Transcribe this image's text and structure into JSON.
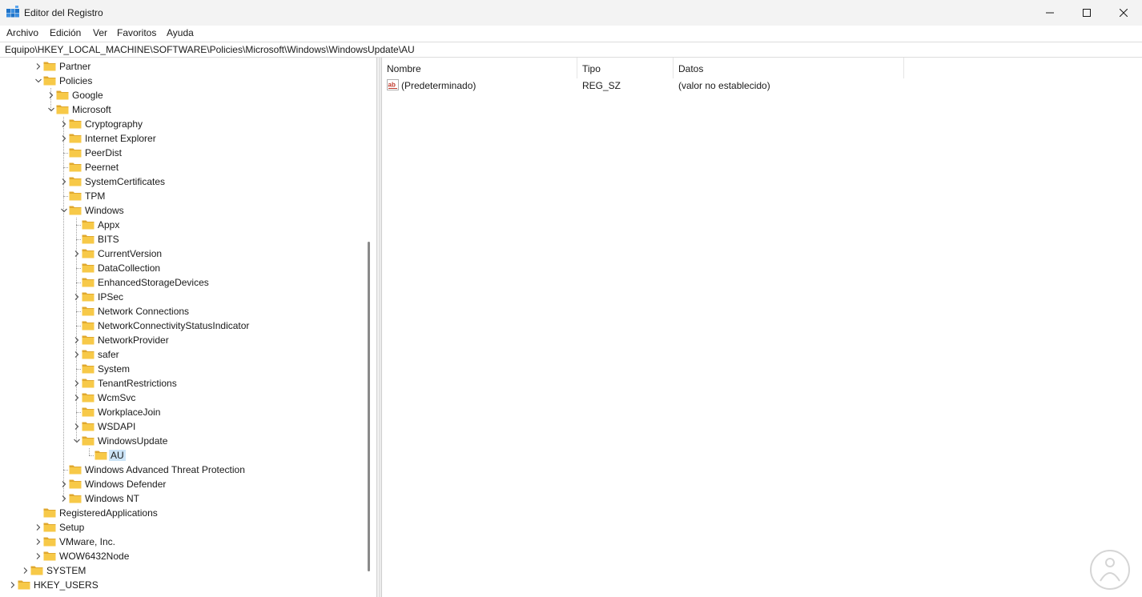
{
  "window": {
    "title": "Editor del Registro",
    "icon": "registry-editor-icon",
    "controls": [
      "minimize-icon",
      "maximize-icon",
      "close-icon"
    ]
  },
  "menu": {
    "items": [
      "Archivo",
      "Edición",
      "Ver",
      "Favoritos",
      "Ayuda"
    ]
  },
  "address": {
    "path": "Equipo\\HKEY_LOCAL_MACHINE\\SOFTWARE\\Policies\\Microsoft\\Windows\\WindowsUpdate\\AU"
  },
  "tree": {
    "items": [
      {
        "label": "Partner",
        "level": 3,
        "expander": "collapsed"
      },
      {
        "label": "Policies",
        "level": 3,
        "expander": "expanded"
      },
      {
        "label": "Google",
        "level": 4,
        "expander": "collapsed"
      },
      {
        "label": "Microsoft",
        "level": 4,
        "expander": "expanded"
      },
      {
        "label": "Cryptography",
        "level": 5,
        "expander": "collapsed"
      },
      {
        "label": "Internet Explorer",
        "level": 5,
        "expander": "collapsed"
      },
      {
        "label": "PeerDist",
        "level": 5,
        "expander": "none"
      },
      {
        "label": "Peernet",
        "level": 5,
        "expander": "none"
      },
      {
        "label": "SystemCertificates",
        "level": 5,
        "expander": "collapsed"
      },
      {
        "label": "TPM",
        "level": 5,
        "expander": "none"
      },
      {
        "label": "Windows",
        "level": 5,
        "expander": "expanded"
      },
      {
        "label": "Appx",
        "level": 6,
        "expander": "none"
      },
      {
        "label": "BITS",
        "level": 6,
        "expander": "none"
      },
      {
        "label": "CurrentVersion",
        "level": 6,
        "expander": "collapsed"
      },
      {
        "label": "DataCollection",
        "level": 6,
        "expander": "none"
      },
      {
        "label": "EnhancedStorageDevices",
        "level": 6,
        "expander": "none"
      },
      {
        "label": "IPSec",
        "level": 6,
        "expander": "collapsed"
      },
      {
        "label": "Network Connections",
        "level": 6,
        "expander": "none"
      },
      {
        "label": "NetworkConnectivityStatusIndicator",
        "level": 6,
        "expander": "none"
      },
      {
        "label": "NetworkProvider",
        "level": 6,
        "expander": "collapsed"
      },
      {
        "label": "safer",
        "level": 6,
        "expander": "collapsed"
      },
      {
        "label": "System",
        "level": 6,
        "expander": "none"
      },
      {
        "label": "TenantRestrictions",
        "level": 6,
        "expander": "collapsed"
      },
      {
        "label": "WcmSvc",
        "level": 6,
        "expander": "collapsed"
      },
      {
        "label": "WorkplaceJoin",
        "level": 6,
        "expander": "none"
      },
      {
        "label": "WSDAPI",
        "level": 6,
        "expander": "collapsed"
      },
      {
        "label": "WindowsUpdate",
        "level": 6,
        "expander": "expanded"
      },
      {
        "label": "AU",
        "level": 7,
        "expander": "none",
        "selected": true
      },
      {
        "label": "Windows Advanced Threat Protection",
        "level": 5,
        "expander": "none"
      },
      {
        "label": "Windows Defender",
        "level": 5,
        "expander": "collapsed"
      },
      {
        "label": "Windows NT",
        "level": 5,
        "expander": "collapsed"
      },
      {
        "label": "RegisteredApplications",
        "level": 3,
        "expander": "none"
      },
      {
        "label": "Setup",
        "level": 3,
        "expander": "collapsed"
      },
      {
        "label": "VMware, Inc.",
        "level": 3,
        "expander": "collapsed"
      },
      {
        "label": "WOW6432Node",
        "level": 3,
        "expander": "collapsed"
      },
      {
        "label": "SYSTEM",
        "level": 2,
        "expander": "collapsed"
      },
      {
        "label": "HKEY_USERS",
        "level": 1,
        "expander": "collapsed"
      }
    ]
  },
  "list": {
    "columns": [
      "Nombre",
      "Tipo",
      "Datos"
    ],
    "rows": [
      {
        "name": "(Predeterminado)",
        "type": "REG_SZ",
        "data": "(valor no establecido)",
        "icon": "string-value-icon"
      }
    ]
  },
  "colors": {
    "folder": "#f7c948",
    "folder_dark": "#e0a82e",
    "selection": "#cce4f7",
    "app_icon": "#1e73c8"
  }
}
